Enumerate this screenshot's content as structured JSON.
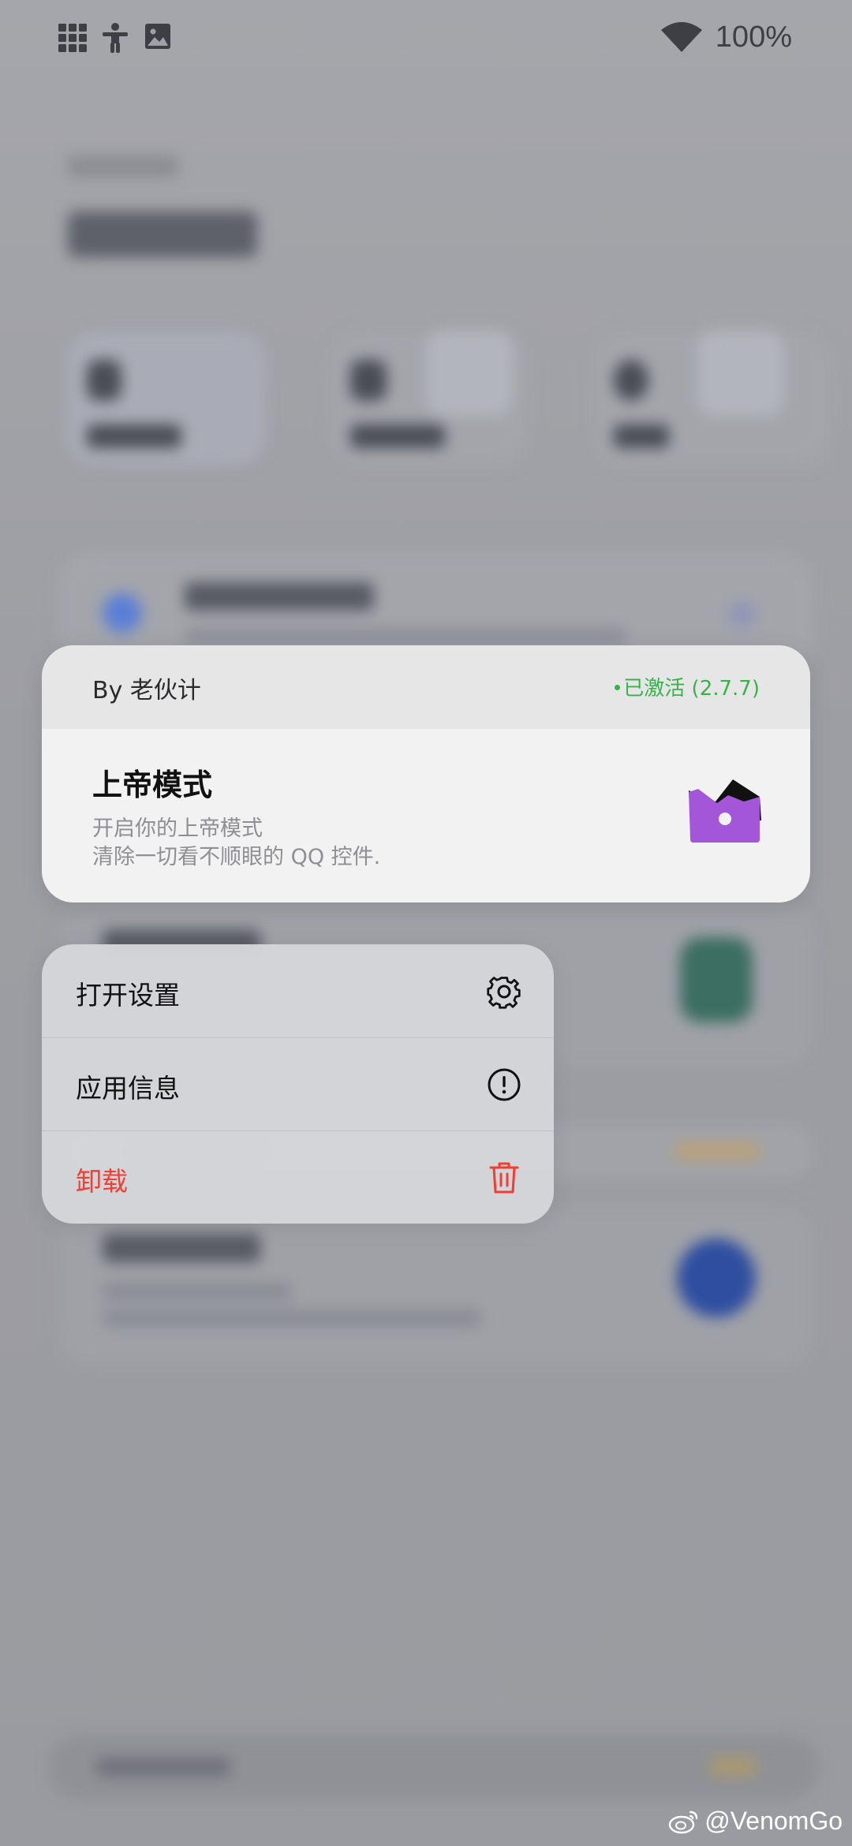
{
  "status_bar": {
    "left_icons": [
      "grid-icon",
      "accessibility-icon",
      "image-icon"
    ],
    "wifi_icon": "wifi-icon",
    "battery": "100%"
  },
  "module_card": {
    "author": "By 老伙计",
    "status": "已激活 (2.7.7)",
    "status_color": "#38b24a",
    "title": "上帝模式",
    "description_line1": "开启你的上帝模式",
    "description_line2": "清除一切看不顺眼的 QQ 控件.",
    "icon": "crown-icon",
    "icon_color": "#a356d8"
  },
  "context_menu": {
    "items": [
      {
        "label": "打开设置",
        "icon": "gear-icon"
      },
      {
        "label": "应用信息",
        "icon": "info-icon"
      },
      {
        "label": "卸载",
        "icon": "trash-icon",
        "color": "#f23d33"
      }
    ]
  },
  "watermark": {
    "text": "@VenomGo",
    "icon": "weibo-icon"
  }
}
